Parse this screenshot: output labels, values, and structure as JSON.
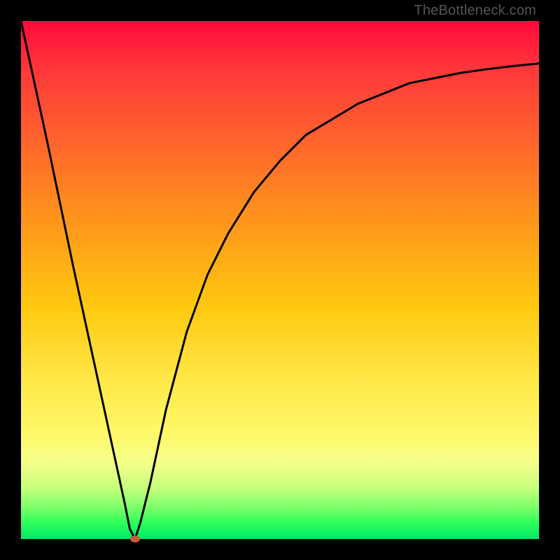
{
  "watermark": "TheBottleneck.com",
  "colors": {
    "frame": "#000000",
    "curve": "#000000",
    "marker": "#c85a3a",
    "gradient_top": "#ff0a3a",
    "gradient_bottom": "#00e96a"
  },
  "chart_data": {
    "type": "line",
    "title": "",
    "xlabel": "",
    "ylabel": "",
    "xlim": [
      0,
      100
    ],
    "ylim": [
      0,
      100
    ],
    "grid": false,
    "legend": false,
    "marker": {
      "x": 22,
      "y": 0,
      "color": "#c85a3a"
    },
    "series": [
      {
        "name": "curve",
        "x": [
          0,
          5,
          10,
          15,
          20,
          21,
          22,
          23,
          25,
          28,
          32,
          36,
          40,
          45,
          50,
          55,
          60,
          65,
          70,
          75,
          80,
          85,
          90,
          95,
          100
        ],
        "y": [
          100,
          77,
          53,
          30,
          7,
          2,
          0,
          3,
          11,
          25,
          40,
          51,
          59,
          67,
          73,
          78,
          81,
          84,
          86,
          88,
          89,
          90,
          90.7,
          91.3,
          91.8
        ]
      }
    ],
    "gradient": {
      "direction": "vertical",
      "stops": [
        {
          "pos": 0,
          "color": "#ff0a3a"
        },
        {
          "pos": 10,
          "color": "#ff3a3a"
        },
        {
          "pos": 25,
          "color": "#ff6a2a"
        },
        {
          "pos": 40,
          "color": "#ff9a1a"
        },
        {
          "pos": 55,
          "color": "#ffc80f"
        },
        {
          "pos": 70,
          "color": "#ffe94a"
        },
        {
          "pos": 80,
          "color": "#fff96a"
        },
        {
          "pos": 85,
          "color": "#f6ff8a"
        },
        {
          "pos": 90,
          "color": "#c8ff7a"
        },
        {
          "pos": 94,
          "color": "#7aff6a"
        },
        {
          "pos": 97,
          "color": "#2aff5a"
        },
        {
          "pos": 100,
          "color": "#00e96a"
        }
      ]
    }
  }
}
